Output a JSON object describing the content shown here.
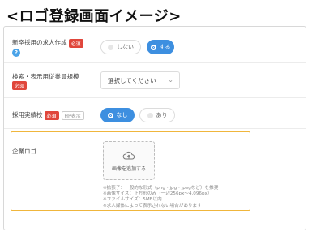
{
  "page_title": "<ロゴ登録画面イメージ>",
  "rows": {
    "new_graduate": {
      "label": "新卒採用の求人作成",
      "required_badge": "必須",
      "options": [
        "しない",
        "する"
      ],
      "selected": "する"
    },
    "employee_count": {
      "label": "検索・表示用従業員規模",
      "required_badge": "必須",
      "select_value": "選択してください"
    },
    "hiring_record": {
      "label": "採用実績校",
      "required_badge": "必須",
      "hp_badge": "HP表示",
      "options": [
        "なし",
        "あり"
      ],
      "selected": "なし"
    },
    "company_logo": {
      "label": "企業ロゴ",
      "upload_label": "画像を追加する",
      "notes": [
        "※拡張子：一般的な形式（png・jpg・jpegなど）を推奨",
        "※画像サイズ：正方形のみ（一辺256px〜4,096px）",
        "※ファイルサイズ：5MB以内",
        "※求人媒体によって表示されない場合があります"
      ]
    }
  },
  "colors": {
    "accent": "#3d8fe0",
    "required": "#e0463b",
    "highlight": "#f0b63c"
  }
}
